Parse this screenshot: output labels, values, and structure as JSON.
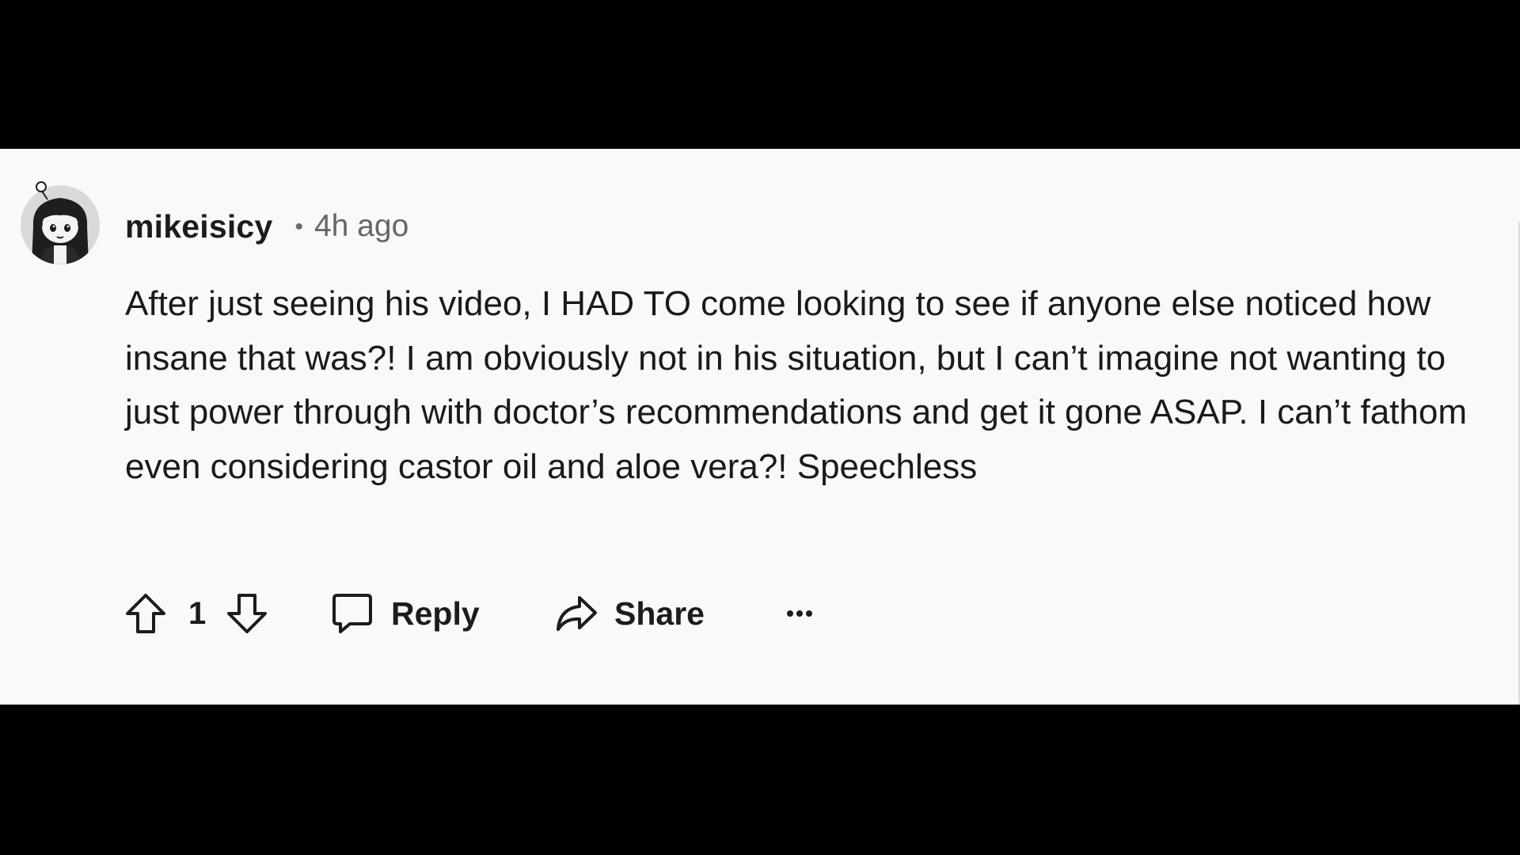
{
  "comment": {
    "avatar_icon": "avatar-icon",
    "username": "mikeisicy",
    "separator": "•",
    "timestamp": "4h ago",
    "body": "After just seeing his video, I HAD TO come looking to see if anyone else noticed how insane that was?! I am obviously not in his situation, but I can’t imagine not wanting to just power through with doctor’s recommendations and get it gone ASAP. I can’t fathom even considering castor oil and aloe vera?! Speechless"
  },
  "actions": {
    "upvote_icon": "upvote-icon",
    "vote_count": "1",
    "downvote_icon": "downvote-icon",
    "reply_icon": "reply-bubble-icon",
    "reply_label": "Reply",
    "share_icon": "share-arrow-icon",
    "share_label": "Share",
    "more_icon": "more-options-icon"
  },
  "colors": {
    "card_background": "#f9f9f9",
    "letterbox": "#000000",
    "text_primary": "#1c1c1c",
    "text_secondary": "#666666"
  }
}
